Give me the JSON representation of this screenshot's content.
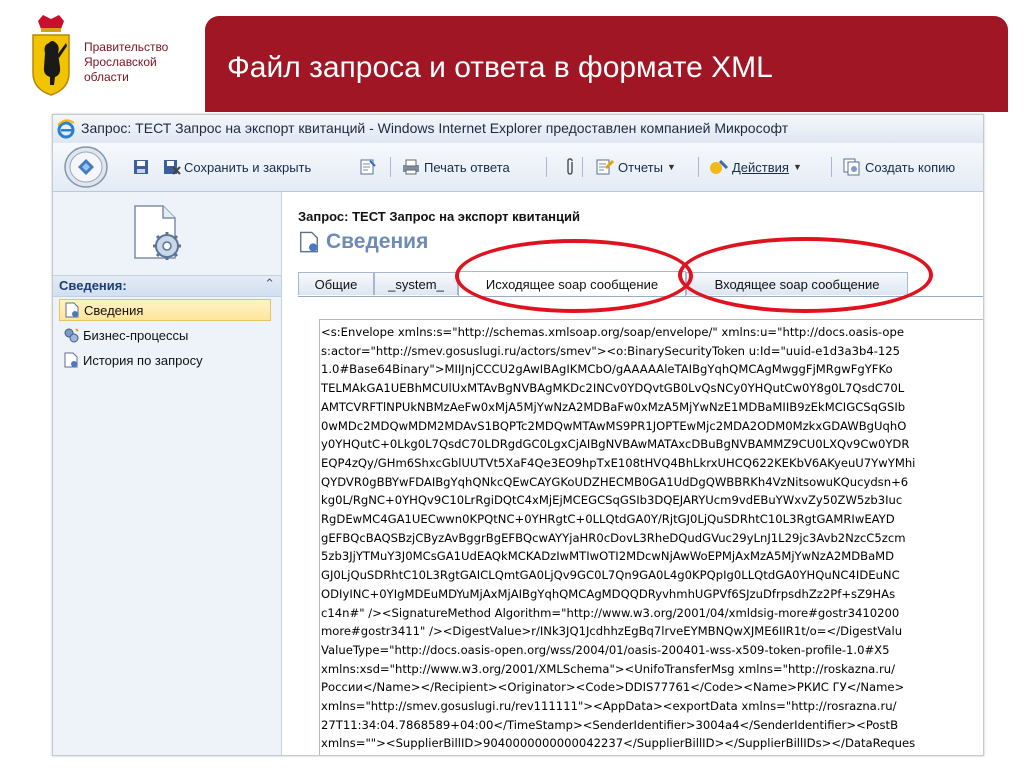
{
  "slide": {
    "org_line1": "Правительство",
    "org_line2": "Ярославской",
    "org_line3": "области",
    "title": "Файл запроса и ответа в формате XML",
    "accent_color": "#a11624",
    "highlight_color": "#e0121f"
  },
  "window": {
    "title": "Запрос: ТЕСТ Запрос на экспорт квитанций - Windows Internet Explorer предоставлен компанией Микрософт",
    "icon": "ie-icon"
  },
  "toolbar": {
    "save_close": "Сохранить и закрыть",
    "print_response": "Печать ответа",
    "reports": "Отчеты",
    "actions": "Действия",
    "create_copy": "Создать копию"
  },
  "sidebar": {
    "header": "Сведения:",
    "items": [
      {
        "label": "Сведения",
        "icon": "document-icon",
        "active": true
      },
      {
        "label": "Бизнес-процессы",
        "icon": "gears-icon",
        "active": false
      },
      {
        "label": "История по запросу",
        "icon": "document-icon",
        "active": false
      }
    ]
  },
  "main": {
    "entity_title": "Запрос: ТЕСТ Запрос на экспорт квитанций",
    "section_title": "Сведения",
    "tabs": [
      {
        "label": "Общие"
      },
      {
        "label": "_system_"
      },
      {
        "label": "Исходящее soap сообщение"
      },
      {
        "label": "Входящее soap сообщение"
      }
    ],
    "active_tab": "Исходящее soap сообщение",
    "xml_lines": [
      "<s:Envelope xmlns:s=\"http://schemas.xmlsoap.org/soap/envelope/\" xmlns:u=\"http://docs.oasis-ope",
      "s:actor=\"http://smev.gosuslugi.ru/actors/smev\"><o:BinarySecurityToken u:Id=\"uuid-e1d3a3b4-125",
      "1.0#Base64Binary\">MIIJnjCCCU2gAwIBAgIKMCbO/gAAAAAleTAIBgYqhQMCAgMwggFjMRgwFgYFKo",
      "TELMAkGA1UEBhMCUlUxMTAvBgNVBAgMKDc2INCv0YDQvtGB0LvQsNCy0YHQutCw0Y8g0L7QsdC70L",
      "AMTCVRFTlNPUkNBMzAeFw0xMjA5MjYwNzA2MDBaFw0xMzA5MjYwNzE1MDBaMIIB9zEkMCIGCSqGSIb",
      "0wMDc2MDQwMDM2MDAvS1BQPTc2MDQwMTAwMS9PR1JOPTEwMjc2MDA2ODM0MzkxGDAWBgUqhO",
      "y0YHQutC+0Lkg0L7QsdC70LDRgdGC0LgxCjAIBgNVBAwMATAxcDBuBgNVBAMMZ9CU0LXQv9Cw0YDR",
      "EQP4zQy/GHm6ShxcGblUUTVt5XaF4Qe3EO9hpTxE108tHVQ4BhLkrxUHCQ622KEKbV6AKyeuU7YwYMhi",
      "QYDVR0gBBYwFDAIBgYqhQNkcQEwCAYGKoUDZHECMB0GA1UdDgQWBBRKh4VzNitsowuKQucydsn+6",
      "kg0L/RgNC+0YHQv9C10LrRgiDQtC4xMjEjMCEGCSqGSIb3DQEJARYUcm9vdEBuYWxvZy50ZW5zb3Iuc",
      "RgDEwMC4GA1UECwwn0KPQtNC+0YHRgtC+0LLQtdGA0Y/RjtGJ0LjQuSDRhtC10L3RgtGAMRIwEAYD",
      "gEFBQcBAQSBzjCByzAvBggrBgEFBQcwAYYjaHR0cDovL3RheDQudGVuc29yLnJ1L29jc3Avb2NzcC5zcm",
      "5zb3JjYTMuY3J0MCsGA1UdEAQkMCKADzIwMTIwOTI2MDcwNjAwWoEPMjAxMzA5MjYwNzA2MDBaMD",
      "GJ0LjQuSDRhtC10L3RgtGAICLQmtGA0LjQv9GC0L7Qn9GA0L4g0KPQpIg0LLQtdGA0YHQuNC4IDEuNC",
      "ODIyINC+0YIgMDEuMDYuMjAxMjAIBgYqhQMCAgMDQQDRyvhmhUGPVf6SJzuDfrpsdhZz2Pf+sZ9HAs",
      "c14n#\" /><SignatureMethod Algorithm=\"http://www.w3.org/2001/04/xmldsig-more#gostr3410200",
      "more#gostr3411\" /><DigestValue>r/INk3JQ1JcdhhzEgBq7lrveEYMBNQwXJME6IIR1t/o=</DigestValu",
      "ValueType=\"http://docs.oasis-open.org/wss/2004/01/oasis-200401-wss-x509-token-profile-1.0#X5",
      "xmlns:xsd=\"http://www.w3.org/2001/XMLSchema\"><UnifoTransferMsg xmlns=\"http://roskazna.ru/",
      "России</Name></Recipient><Originator><Code>DDIS77761</Code><Name>РКИС ГУ</Name>",
      "xmlns=\"http://smev.gosuslugi.ru/rev111111\"><AppData><exportData xmlns=\"http://rosrazna.ru/",
      "27T11:34:04.7868589+04:00</TimeStamp><SenderIdentifier>3004a4</SenderIdentifier><PostB",
      "xmlns=\"\"><SupplierBillID>9040000000000042237</SupplierBillID></SupplierBillIDs></DataReques"
    ]
  }
}
